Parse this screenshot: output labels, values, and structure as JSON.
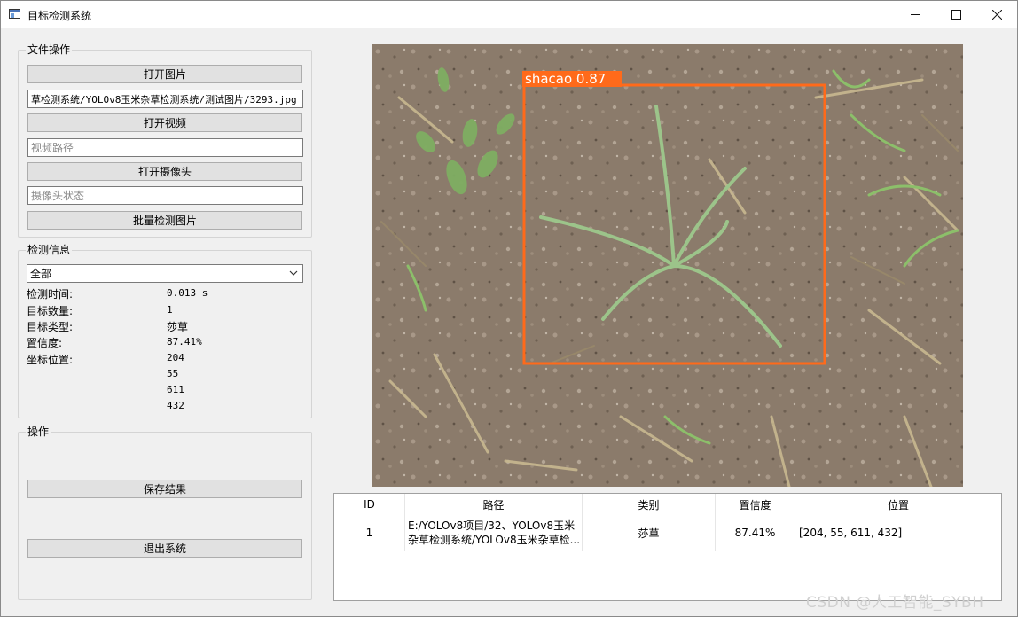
{
  "window": {
    "title": "目标检测系统"
  },
  "file_ops": {
    "title": "文件操作",
    "open_image_label": "打开图片",
    "image_path_value": "草检测系统/YOLOv8玉米杂草检测系统/测试图片/3293.jpg",
    "open_video_label": "打开视频",
    "video_path_placeholder": "视频路径",
    "open_camera_label": "打开摄像头",
    "camera_status_placeholder": "摄像头状态",
    "batch_detect_label": "批量检测图片"
  },
  "detect_info": {
    "title": "检测信息",
    "filter_selected": "全部",
    "time_label": "检测时间:",
    "time_value": "0.013 s",
    "count_label": "目标数量:",
    "count_value": "1",
    "type_label": "目标类型:",
    "type_value": "莎草",
    "conf_label": "置信度:",
    "conf_value": "87.41%",
    "pos_label": "坐标位置:",
    "pos_values": [
      "204",
      "55",
      "611",
      "432"
    ]
  },
  "actions": {
    "title": "操作",
    "save_label": "保存结果",
    "exit_label": "退出系统"
  },
  "detection_overlay": {
    "label": "shacao 0.87",
    "color": "#ff6a1a"
  },
  "results_table": {
    "headers": [
      "ID",
      "路径",
      "类别",
      "置信度",
      "位置"
    ],
    "rows": [
      {
        "id": "1",
        "path_line1": "E:/YOLOv8项目/32、YOLOv8玉米",
        "path_line2": "杂草检测系统/YOLOv8玉米杂草检...",
        "category": "莎草",
        "confidence": "87.41%",
        "position": "[204, 55, 611, 432]"
      }
    ]
  },
  "watermark": "CSDN @人工智能_SYBH"
}
